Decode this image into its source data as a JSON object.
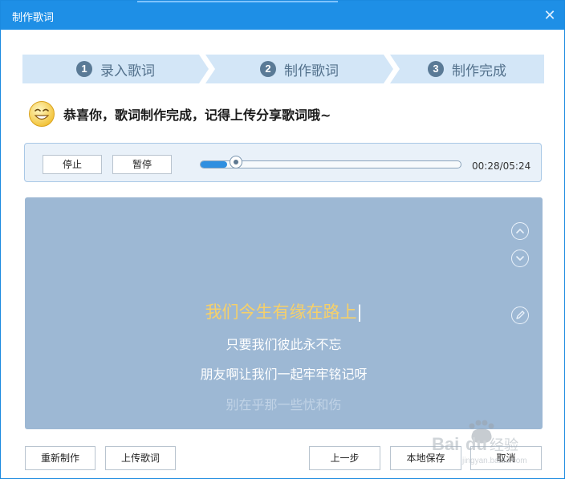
{
  "window": {
    "title": "制作歌词",
    "close_icon": "close-icon"
  },
  "steps": [
    {
      "num": "1",
      "label": "录入歌词"
    },
    {
      "num": "2",
      "label": "制作歌词"
    },
    {
      "num": "3",
      "label": "制作完成"
    }
  ],
  "congrats": {
    "icon": "smiley-icon",
    "text": "恭喜你，歌词制作完成，记得上传分享歌词哦~"
  },
  "player": {
    "stop_label": "停止",
    "pause_label": "暂停",
    "progress_fraction": 0.088,
    "time": "00:28/05:24"
  },
  "lyrics": {
    "current": "我们今生有缘在路上",
    "next1": "只要我们彼此永不忘",
    "next2": "朋友啊让我们一起牢牢铭记呀",
    "next3": "别在乎那一些忧和伤",
    "controls": [
      "scroll-up-icon",
      "scroll-down-icon",
      "edit-icon"
    ]
  },
  "bottom": {
    "redo_label": "重新制作",
    "upload_label": "上传歌词",
    "prev_label": "上一步",
    "save_label": "本地保存",
    "cancel_label": "取消"
  },
  "colors": {
    "title_bar": "#1e8fe6",
    "lyrics_bg": "#9db8d4",
    "current_lyric": "#f6d06a",
    "progress": "#2f8fe0"
  },
  "watermark": {
    "text": "Baidu 经验",
    "subtext": "jingyan.baidu.com"
  }
}
